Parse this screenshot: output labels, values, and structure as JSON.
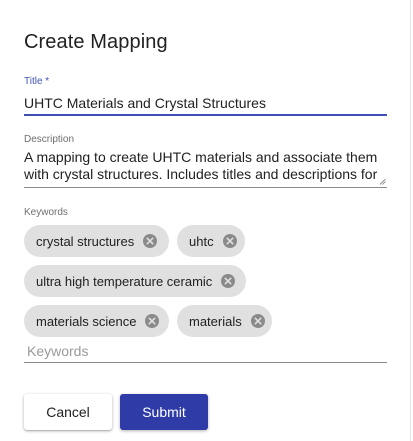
{
  "dialog": {
    "title": "Create Mapping"
  },
  "form": {
    "title_label": "Title *",
    "title_value": "UHTC Materials and Crystal Structures",
    "description_label": "Description",
    "description_line1": "A mapping to create UHTC materials and associate them",
    "description_line2": "with crystal structures. Includes titles and descriptions for",
    "keywords_label": "Keywords",
    "keywords_placeholder": "Keywords",
    "keywords": [
      {
        "label": "crystal structures"
      },
      {
        "label": "uhtc"
      },
      {
        "label": "ultra high temperature ceramic"
      },
      {
        "label": "materials science"
      },
      {
        "label": "materials"
      }
    ]
  },
  "actions": {
    "cancel_label": "Cancel",
    "submit_label": "Submit"
  },
  "colors": {
    "accent": "#3f51b5",
    "submit_bg": "#2f3ba6",
    "chip_bg": "#e0e0e0",
    "chip_icon": "#8a8a8a"
  },
  "icons": {
    "chip_remove": "cancel-circle-icon",
    "resize": "resize-grip-icon"
  }
}
